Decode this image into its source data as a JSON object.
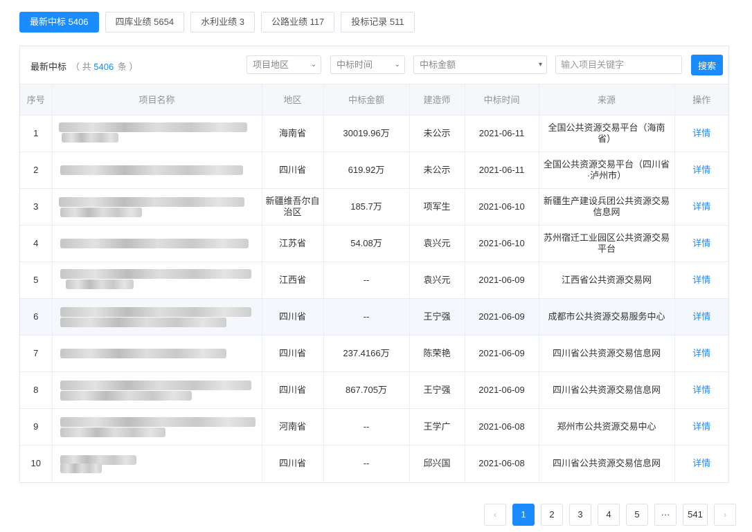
{
  "tabs": [
    {
      "label": "最新中标 5406"
    },
    {
      "label": "四库业绩 5654"
    },
    {
      "label": "水利业绩 3"
    },
    {
      "label": "公路业绩 117"
    },
    {
      "label": "投标记录 511"
    }
  ],
  "panel": {
    "title": "最新中标",
    "count_prefix": "（ 共",
    "count": "5406",
    "count_suffix": "条 ）"
  },
  "filters": {
    "region": "项目地区",
    "time": "中标时间",
    "amount": "中标金额",
    "keyword_placeholder": "输入项目关键字",
    "search": "搜索"
  },
  "columns": [
    "序号",
    "项目名称",
    "地区",
    "中标金额",
    "建造师",
    "中标时间",
    "来源",
    "操作"
  ],
  "rows": [
    {
      "no": "1",
      "region": "海南省",
      "amount": "30019.96万",
      "builder": "未公示",
      "date": "2021-06-11",
      "source": "全国公共资源交易平台（海南省）",
      "action": "详情"
    },
    {
      "no": "2",
      "region": "四川省",
      "amount": "619.92万",
      "builder": "未公示",
      "date": "2021-06-11",
      "source": "全国公共资源交易平台（四川省·泸州市）",
      "action": "详情"
    },
    {
      "no": "3",
      "region": "新疆维吾尔自治区",
      "amount": "185.7万",
      "builder": "项军生",
      "date": "2021-06-10",
      "source": "新疆生产建设兵团公共资源交易信息网",
      "action": "详情"
    },
    {
      "no": "4",
      "region": "江苏省",
      "amount": "54.08万",
      "builder": "袁兴元",
      "date": "2021-06-10",
      "source": "苏州宿迁工业园区公共资源交易平台",
      "action": "详情"
    },
    {
      "no": "5",
      "region": "江西省",
      "amount": "--",
      "builder": "袁兴元",
      "date": "2021-06-09",
      "source": "江西省公共资源交易网",
      "action": "详情"
    },
    {
      "no": "6",
      "region": "四川省",
      "amount": "--",
      "builder": "王宁强",
      "date": "2021-06-09",
      "source": "成都市公共资源交易服务中心",
      "action": "详情"
    },
    {
      "no": "7",
      "region": "四川省",
      "amount": "237.4166万",
      "builder": "陈荣艳",
      "date": "2021-06-09",
      "source": "四川省公共资源交易信息网",
      "action": "详情"
    },
    {
      "no": "8",
      "region": "四川省",
      "amount": "867.705万",
      "builder": "王宁强",
      "date": "2021-06-09",
      "source": "四川省公共资源交易信息网",
      "action": "详情"
    },
    {
      "no": "9",
      "region": "河南省",
      "amount": "--",
      "builder": "王学广",
      "date": "2021-06-08",
      "source": "郑州市公共资源交易中心",
      "action": "详情"
    },
    {
      "no": "10",
      "region": "四川省",
      "amount": "--",
      "builder": "邱兴国",
      "date": "2021-06-08",
      "source": "四川省公共资源交易信息网",
      "action": "详情"
    }
  ],
  "pagination": {
    "prev": "‹",
    "pages": [
      "1",
      "2",
      "3",
      "4",
      "5"
    ],
    "ellipsis": "···",
    "last": "541",
    "next": "›",
    "current": "1"
  }
}
